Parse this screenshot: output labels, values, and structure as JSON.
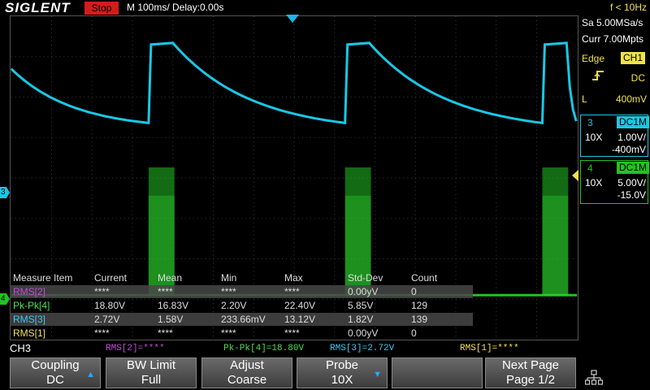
{
  "header": {
    "brand": "SIGLENT",
    "run_state": "Stop",
    "timebase": "M 100ms/  Delay:0.00s"
  },
  "right_panel": {
    "freq": "f < 10Hz",
    "sample_rate": "Sa 5.00MSa/s",
    "memory": "Curr 7.00Mpts",
    "trigger": {
      "type": "Edge",
      "source": "CH1",
      "coupling": "DC",
      "level_label": "L",
      "level": "400mV"
    },
    "ch3": {
      "num": "3",
      "mode": "DC1M",
      "probe": "10X",
      "scale": "1.00V/",
      "offset": "-400mV"
    },
    "ch4": {
      "num": "4",
      "mode": "DC1M",
      "probe": "10X",
      "scale": "5.00V/",
      "offset": "-15.0V"
    }
  },
  "markers": {
    "ch3": "3",
    "ch4": "4"
  },
  "measurements": {
    "headers": [
      "Measure Item",
      "Current",
      "Mean",
      "Min",
      "Max",
      "Std-Dev",
      "Count"
    ],
    "rows": [
      {
        "cells": [
          "RMS[2]",
          "****",
          "****",
          "****",
          "****",
          "0.00yV",
          "0"
        ],
        "color": "#c24bd6"
      },
      {
        "cells": [
          "Pk-Pk[4]",
          "18.80V",
          "16.83V",
          "2.20V",
          "22.40V",
          "5.85V",
          "129"
        ],
        "color": "#4ee04e"
      },
      {
        "cells": [
          "RMS[3]",
          "2.72V",
          "1.58V",
          "233.66mV",
          "13.12V",
          "1.82V",
          "139"
        ],
        "color": "#3fc8f0"
      },
      {
        "cells": [
          "RMS[1]",
          "****",
          "****",
          "****",
          "****",
          "0.00yV",
          "0"
        ],
        "color": "#f0e24a"
      }
    ]
  },
  "status": {
    "channel": "CH3",
    "items": [
      {
        "text": "RMS[2]=****",
        "color": "#c24bd6"
      },
      {
        "text": "Pk-Pk[4]=18.80V",
        "color": "#4ee04e"
      },
      {
        "text": "RMS[3]=2.72V",
        "color": "#3fc8f0"
      },
      {
        "text": "RMS[1]=****",
        "color": "#f0e24a"
      }
    ]
  },
  "softkeys": [
    {
      "line1": "Coupling",
      "line2": "DC",
      "arrow": "▲"
    },
    {
      "line1": "BW Limit",
      "line2": "Full",
      "arrow": ""
    },
    {
      "line1": "Adjust",
      "line2": "Coarse",
      "arrow": ""
    },
    {
      "line1": "Probe",
      "line2": "10X",
      "arrow": "▼"
    },
    {
      "line1": "",
      "line2": "",
      "arrow": ""
    },
    {
      "line1": "Next Page",
      "line2": "Page 1/2",
      "arrow": ""
    }
  ],
  "colors": {
    "ch3": "#19c8e6",
    "ch4": "#22c322",
    "trigger_accent": "#f0e24a",
    "stop_bg": "#d41c1c"
  },
  "icons": {
    "network": "network-icon"
  }
}
